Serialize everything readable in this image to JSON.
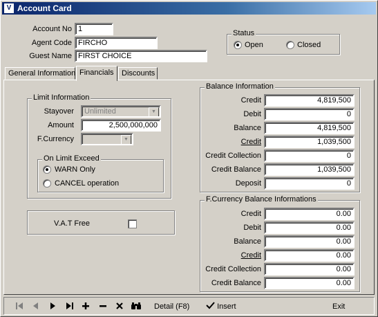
{
  "window": {
    "title": "Account Card",
    "app_icon": "vs-icon"
  },
  "header": {
    "account_no_label": "Account No",
    "account_no_value": "1",
    "agent_code_label": "Agent Code",
    "agent_code_value": "FIRCHO",
    "guest_name_label": "Guest Name",
    "guest_name_value": "FIRST CHOICE"
  },
  "status": {
    "title": "Status",
    "open_label": "Open",
    "closed_label": "Closed",
    "selected": "Open"
  },
  "tabs": [
    {
      "label": "General Information"
    },
    {
      "label": "Financials"
    },
    {
      "label": "Discounts"
    }
  ],
  "limit_info": {
    "title": "Limit Information",
    "stayover_label": "Stayover",
    "stayover_value": "Unlimited",
    "amount_label": "Amount",
    "amount_value": "2,500,000,000",
    "fcurrency_label": "F.Currency",
    "fcurrency_value": ""
  },
  "on_limit": {
    "title": "On Limit Exceed",
    "warn_label": "WARN Only",
    "cancel_label": "CANCEL operation",
    "selected": "WARN Only"
  },
  "vat": {
    "label": "V.A.T Free",
    "checked": false
  },
  "balance": {
    "title": "Balance Information",
    "rows": [
      {
        "label": "Credit",
        "value": "4,819,500"
      },
      {
        "label": "Debit",
        "value": "0"
      },
      {
        "label": "Balance",
        "value": "4,819,500"
      },
      {
        "label": "Credit",
        "value": "1,039,500"
      },
      {
        "label": "Credit Collection",
        "value": "0"
      },
      {
        "label": "Credit Balance",
        "value": "1,039,500"
      },
      {
        "label": "Deposit",
        "value": "0"
      }
    ]
  },
  "fcurrency_balance": {
    "title": "F.Currency Balance Informations",
    "rows": [
      {
        "label": "Credit",
        "value": "0.00"
      },
      {
        "label": "Debit",
        "value": "0.00"
      },
      {
        "label": "Balance",
        "value": "0.00"
      },
      {
        "label": "Credit",
        "value": "0.00"
      },
      {
        "label": "Credit Collection",
        "value": "0.00"
      },
      {
        "label": "Credit Balance",
        "value": "0.00"
      }
    ]
  },
  "toolbar": {
    "first_icon": "first-record-icon",
    "prev_icon": "prev-record-icon",
    "next_icon": "next-record-icon",
    "last_icon": "last-record-icon",
    "add_icon": "add-icon",
    "delete_icon": "delete-icon",
    "cancel_icon": "cancel-icon",
    "find_icon": "binoculars-icon",
    "detail_label": "Detail (F8)",
    "insert_label": "Insert",
    "exit_label": "Exit"
  }
}
